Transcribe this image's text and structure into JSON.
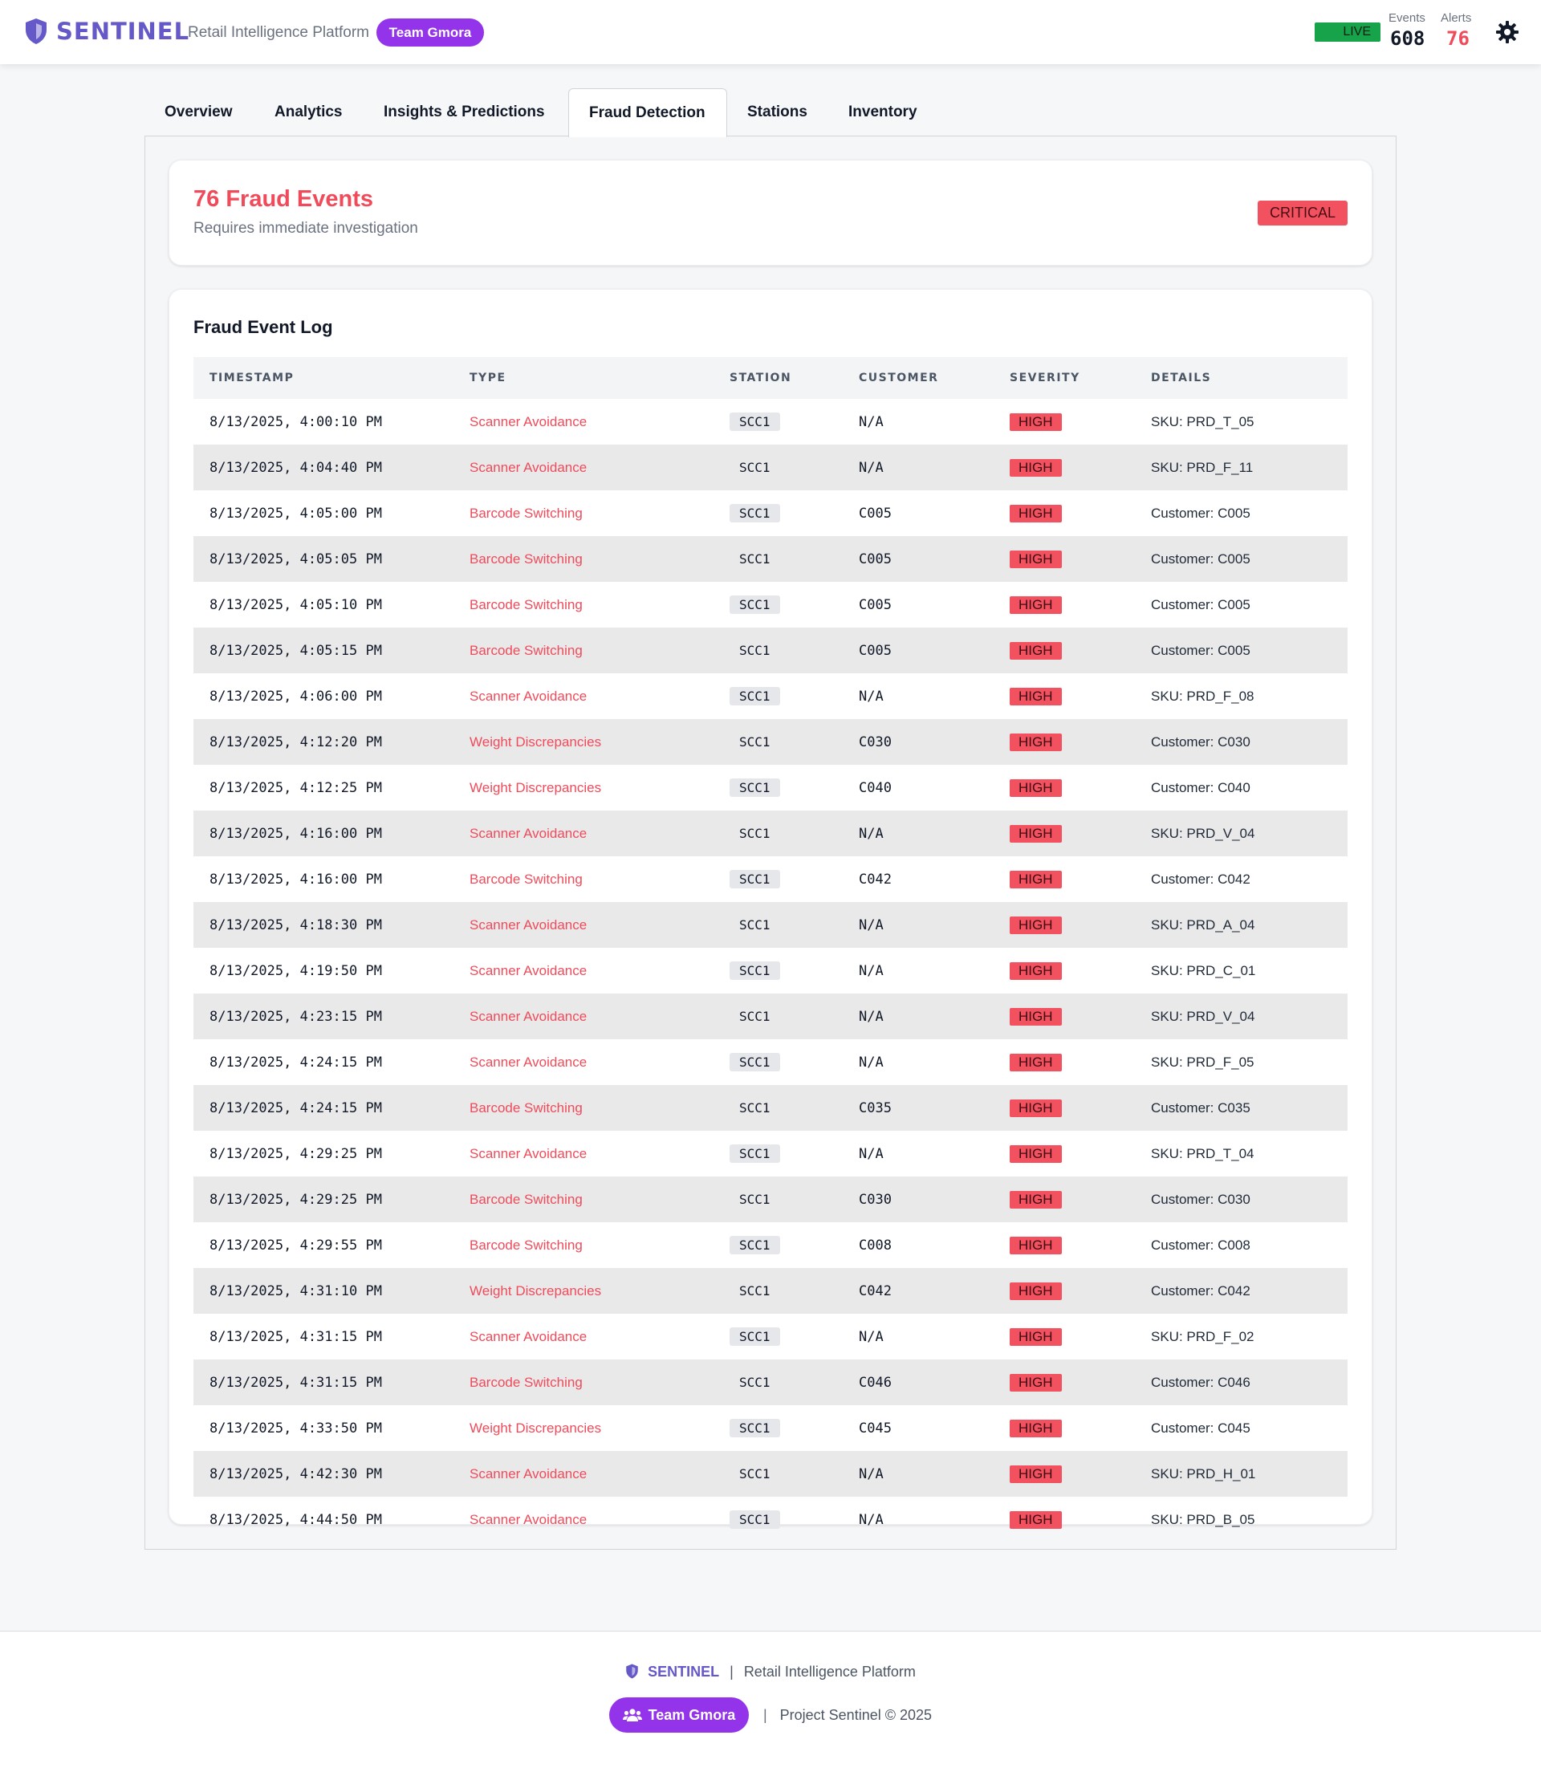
{
  "header": {
    "brand": "SENTINEL",
    "subtitle": "Retail Intelligence Platform",
    "team": "Team Gmora",
    "live": "LIVE",
    "events_label": "Events",
    "events_value": "608",
    "alerts_label": "Alerts",
    "alerts_value": "76",
    "icons": {
      "logo": "shield-icon",
      "settings": "gear-icon"
    }
  },
  "tabs": [
    {
      "label": "Overview",
      "active": false
    },
    {
      "label": "Analytics",
      "active": false
    },
    {
      "label": "Insights & Predictions",
      "active": false
    },
    {
      "label": "Fraud Detection",
      "active": true
    },
    {
      "label": "Stations",
      "active": false
    },
    {
      "label": "Inventory",
      "active": false
    }
  ],
  "alert": {
    "title": "76 Fraud Events",
    "subtitle": "Requires immediate investigation",
    "badge": "CRITICAL"
  },
  "log": {
    "title": "Fraud Event Log",
    "columns": [
      "TIMESTAMP",
      "TYPE",
      "STATION",
      "CUSTOMER",
      "SEVERITY",
      "DETAILS"
    ],
    "rows": [
      [
        "8/13/2025, 4:00:10 PM",
        "Scanner Avoidance",
        "SCC1",
        "N/A",
        "HIGH",
        "SKU: PRD_T_05"
      ],
      [
        "8/13/2025, 4:04:40 PM",
        "Scanner Avoidance",
        "SCC1",
        "N/A",
        "HIGH",
        "SKU: PRD_F_11"
      ],
      [
        "8/13/2025, 4:05:00 PM",
        "Barcode Switching",
        "SCC1",
        "C005",
        "HIGH",
        "Customer: C005"
      ],
      [
        "8/13/2025, 4:05:05 PM",
        "Barcode Switching",
        "SCC1",
        "C005",
        "HIGH",
        "Customer: C005"
      ],
      [
        "8/13/2025, 4:05:10 PM",
        "Barcode Switching",
        "SCC1",
        "C005",
        "HIGH",
        "Customer: C005"
      ],
      [
        "8/13/2025, 4:05:15 PM",
        "Barcode Switching",
        "SCC1",
        "C005",
        "HIGH",
        "Customer: C005"
      ],
      [
        "8/13/2025, 4:06:00 PM",
        "Scanner Avoidance",
        "SCC1",
        "N/A",
        "HIGH",
        "SKU: PRD_F_08"
      ],
      [
        "8/13/2025, 4:12:20 PM",
        "Weight Discrepancies",
        "SCC1",
        "C030",
        "HIGH",
        "Customer: C030"
      ],
      [
        "8/13/2025, 4:12:25 PM",
        "Weight Discrepancies",
        "SCC1",
        "C040",
        "HIGH",
        "Customer: C040"
      ],
      [
        "8/13/2025, 4:16:00 PM",
        "Scanner Avoidance",
        "SCC1",
        "N/A",
        "HIGH",
        "SKU: PRD_V_04"
      ],
      [
        "8/13/2025, 4:16:00 PM",
        "Barcode Switching",
        "SCC1",
        "C042",
        "HIGH",
        "Customer: C042"
      ],
      [
        "8/13/2025, 4:18:30 PM",
        "Scanner Avoidance",
        "SCC1",
        "N/A",
        "HIGH",
        "SKU: PRD_A_04"
      ],
      [
        "8/13/2025, 4:19:50 PM",
        "Scanner Avoidance",
        "SCC1",
        "N/A",
        "HIGH",
        "SKU: PRD_C_01"
      ],
      [
        "8/13/2025, 4:23:15 PM",
        "Scanner Avoidance",
        "SCC1",
        "N/A",
        "HIGH",
        "SKU: PRD_V_04"
      ],
      [
        "8/13/2025, 4:24:15 PM",
        "Scanner Avoidance",
        "SCC1",
        "N/A",
        "HIGH",
        "SKU: PRD_F_05"
      ],
      [
        "8/13/2025, 4:24:15 PM",
        "Barcode Switching",
        "SCC1",
        "C035",
        "HIGH",
        "Customer: C035"
      ],
      [
        "8/13/2025, 4:29:25 PM",
        "Scanner Avoidance",
        "SCC1",
        "N/A",
        "HIGH",
        "SKU: PRD_T_04"
      ],
      [
        "8/13/2025, 4:29:25 PM",
        "Barcode Switching",
        "SCC1",
        "C030",
        "HIGH",
        "Customer: C030"
      ],
      [
        "8/13/2025, 4:29:55 PM",
        "Barcode Switching",
        "SCC1",
        "C008",
        "HIGH",
        "Customer: C008"
      ],
      [
        "8/13/2025, 4:31:10 PM",
        "Weight Discrepancies",
        "SCC1",
        "C042",
        "HIGH",
        "Customer: C042"
      ],
      [
        "8/13/2025, 4:31:15 PM",
        "Scanner Avoidance",
        "SCC1",
        "N/A",
        "HIGH",
        "SKU: PRD_F_02"
      ],
      [
        "8/13/2025, 4:31:15 PM",
        "Barcode Switching",
        "SCC1",
        "C046",
        "HIGH",
        "Customer: C046"
      ],
      [
        "8/13/2025, 4:33:50 PM",
        "Weight Discrepancies",
        "SCC1",
        "C045",
        "HIGH",
        "Customer: C045"
      ],
      [
        "8/13/2025, 4:42:30 PM",
        "Scanner Avoidance",
        "SCC1",
        "N/A",
        "HIGH",
        "SKU: PRD_H_01"
      ],
      [
        "8/13/2025, 4:44:50 PM",
        "Scanner Avoidance",
        "SCC1",
        "N/A",
        "HIGH",
        "SKU: PRD_B_05"
      ]
    ]
  },
  "footer": {
    "brand": "SENTINEL",
    "separator": "|",
    "subtitle": "Retail Intelligence Platform",
    "team": "Team Gmora",
    "copyright": "Project Sentinel © 2025",
    "icons": {
      "logo": "shield-icon",
      "team": "users-icon"
    }
  },
  "colors": {
    "brand": "#6558c8",
    "team_pill": "#9333ea",
    "danger": "#ef4b5a",
    "live": "#16a34a"
  }
}
